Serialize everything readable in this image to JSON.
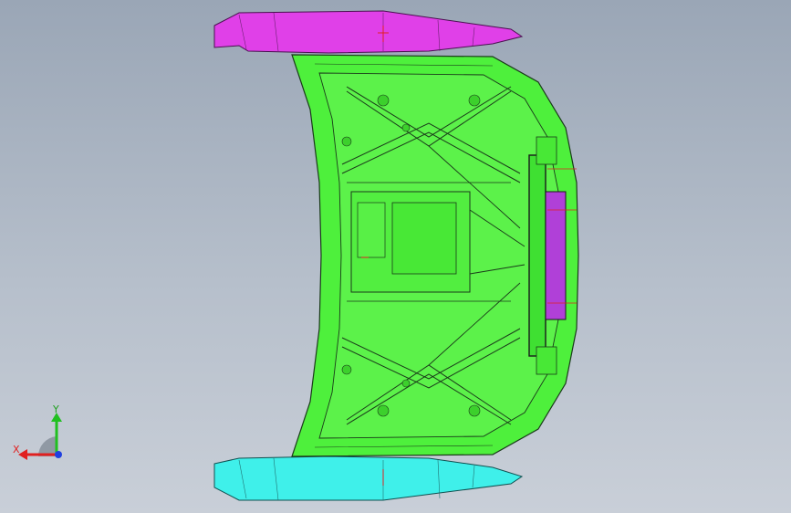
{
  "viewport": {
    "background_top": "#9aa6b6",
    "background_bottom": "#c9cfd8"
  },
  "model": {
    "parts": [
      {
        "name": "top-flange",
        "color": "#e040e8"
      },
      {
        "name": "inner-frame",
        "color": "#4ef03c"
      },
      {
        "name": "bottom-flange",
        "color": "#3ff0ea"
      },
      {
        "name": "latch-bracket",
        "color": "#b040d8"
      }
    ],
    "edge_color": "#1a3a1a"
  },
  "triad": {
    "x_label": "X",
    "y_label": "Y",
    "x_color": "#e02020",
    "y_color": "#20c020",
    "z_color": "#2040e0"
  }
}
